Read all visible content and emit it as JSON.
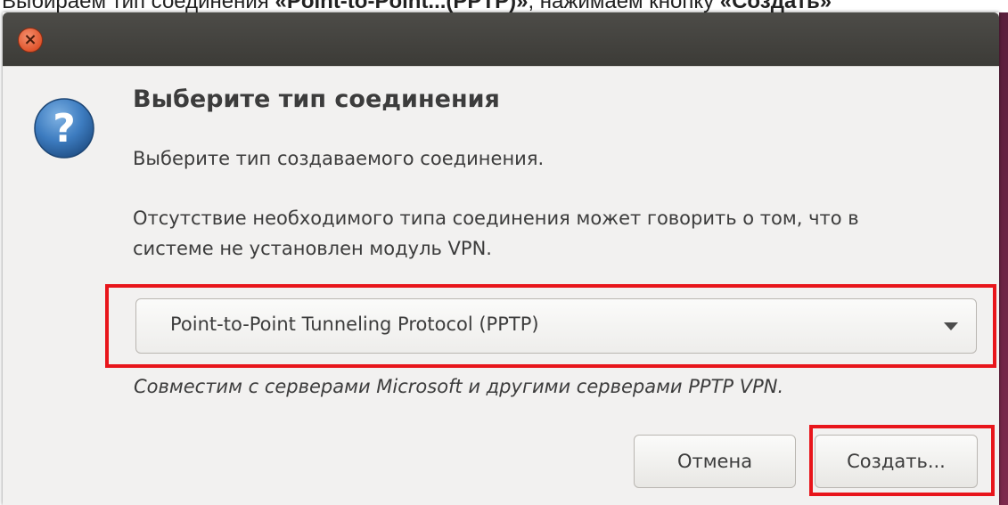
{
  "caption": {
    "prefix": "Выбираем тип соединения ",
    "bold1": "«Point-to-Point...(PPTP)»",
    "middle": ", нажимаем кнопку ",
    "bold2": "«Создать»"
  },
  "dialog": {
    "close_glyph": "×",
    "heading": "Выберите тип соединения",
    "subtext": "Выберите тип создаваемого соединения.",
    "warning": "Отсутствие необходимого типа соединения может говорить о том, что в системе не установлен модуль VPN.",
    "connection_type": {
      "selected": "Point-to-Point Tunneling Protocol (PPTP)"
    },
    "hint": "Совместим с серверами Microsoft и другими серверами PPTP VPN.",
    "buttons": {
      "cancel": "Отмена",
      "create": "Создать..."
    }
  },
  "icons": {
    "close": "close-icon",
    "question": "question-icon",
    "dropdown": "chevron-down-icon"
  },
  "colors": {
    "highlight": "#e8151b",
    "titlebar": "#3c3b37",
    "close_button": "#e0552d",
    "question_icon": "#2f6fae",
    "dialog_bg": "#f2f1f0"
  }
}
